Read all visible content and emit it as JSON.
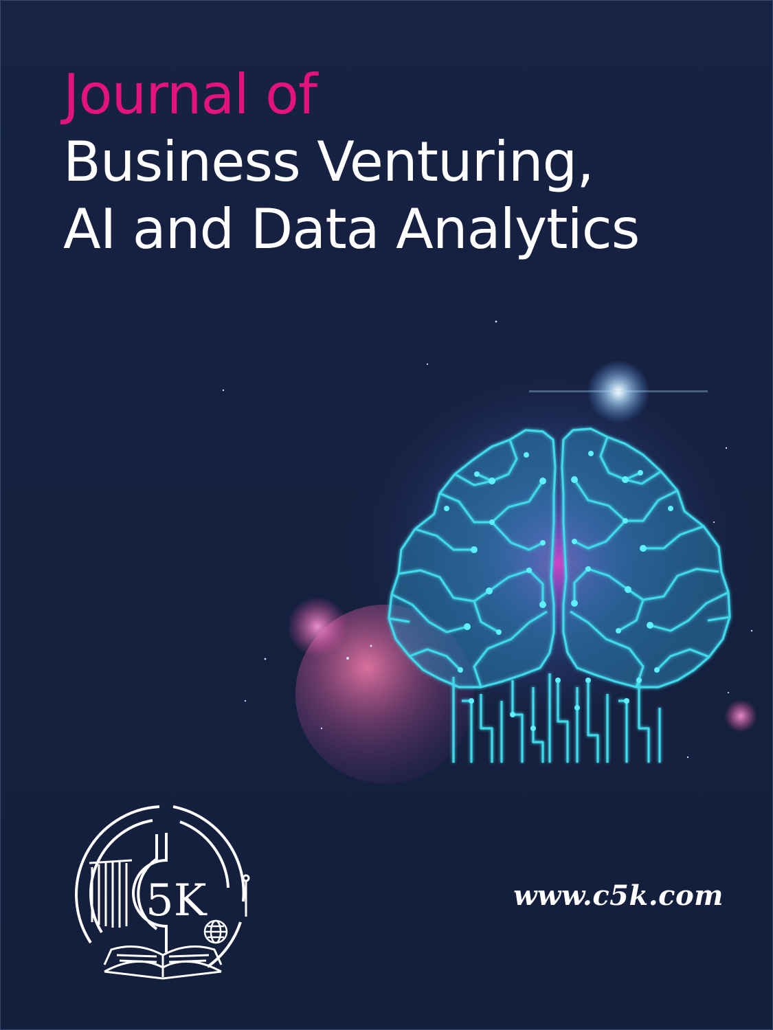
{
  "cover": {
    "title_line_1": "Journal of",
    "title_line_2": "Business Venturing,",
    "title_line_3": "AI and Data Analytics",
    "website": "www.c5k.com",
    "logo_text": "5K"
  },
  "colors": {
    "background": "#15203f",
    "accent_pink": "#e3127d",
    "title_white": "#ffffff",
    "brain_cyan": "#3fd8ea"
  },
  "illustration": {
    "subject": "circuit-brain-icon",
    "logo_icon": "open-book-logo-icon"
  }
}
